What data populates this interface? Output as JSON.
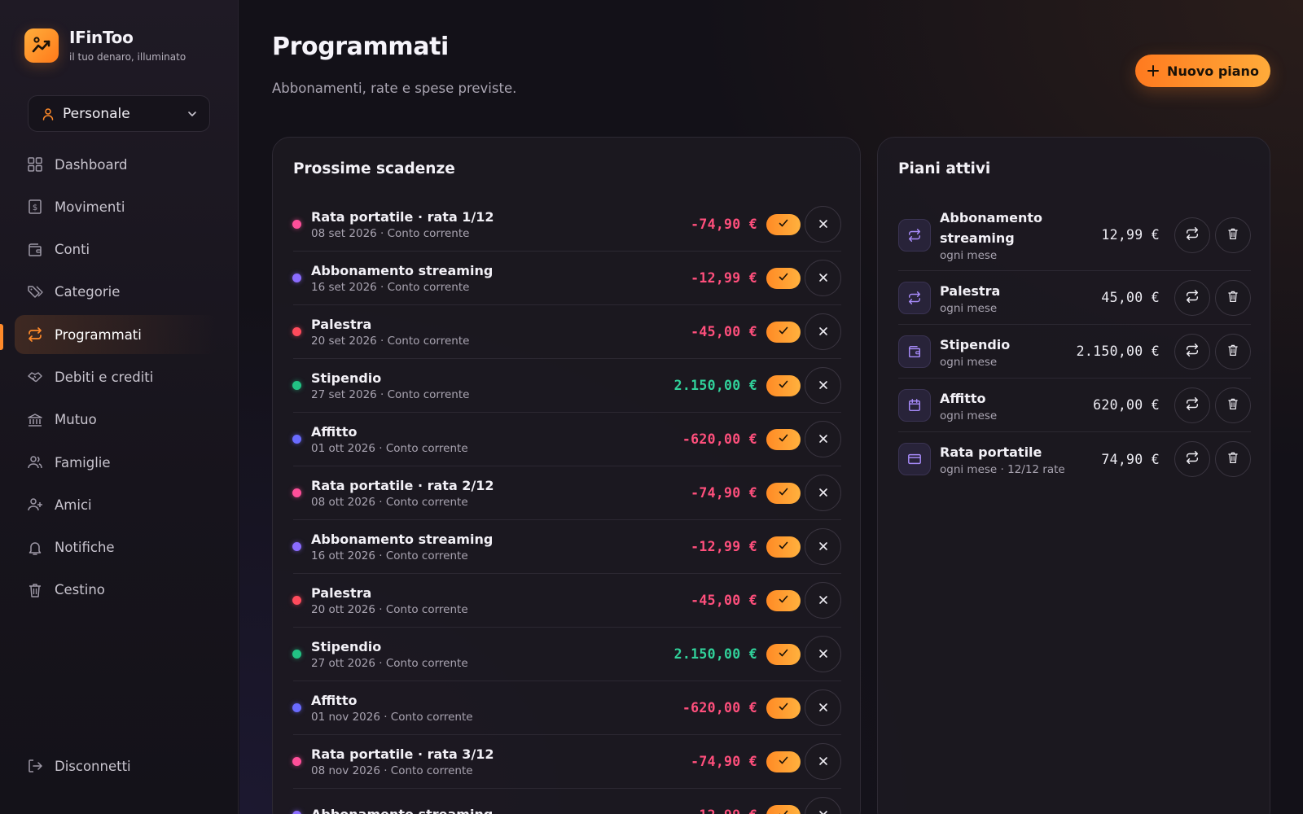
{
  "brand": {
    "name": "IFinToo",
    "tagline": "il tuo denaro, illuminato"
  },
  "profile": {
    "label": "Personale"
  },
  "nav": [
    {
      "label": "Dashboard",
      "icon": "dashboard-icon"
    },
    {
      "label": "Movimenti",
      "icon": "receipt-icon"
    },
    {
      "label": "Conti",
      "icon": "wallet-icon"
    },
    {
      "label": "Categorie",
      "icon": "tags-icon"
    },
    {
      "label": "Programmati",
      "icon": "repeat-icon",
      "active": true
    },
    {
      "label": "Debiti e crediti",
      "icon": "handshake-icon"
    },
    {
      "label": "Mutuo",
      "icon": "bank-icon"
    },
    {
      "label": "Famiglie",
      "icon": "users-icon"
    },
    {
      "label": "Amici",
      "icon": "user-plus-icon"
    },
    {
      "label": "Notifiche",
      "icon": "bell-icon"
    },
    {
      "label": "Cestino",
      "icon": "trash-icon"
    }
  ],
  "logout": {
    "label": "Disconnetti"
  },
  "page": {
    "title": "Programmati",
    "subtitle": "Abbonamenti, rate e spese previste.",
    "new_button": "Nuovo piano"
  },
  "upcoming": {
    "title": "Prossime scadenze",
    "rows": [
      {
        "title": "Rata portatile · rata 1/12",
        "meta": "08 set 2026 · Conto corrente",
        "amount": "-74,90 €",
        "sign": "neg",
        "dot": "#ff4f9a"
      },
      {
        "title": "Abbonamento streaming",
        "meta": "16 set 2026 · Conto corrente",
        "amount": "-12,99 €",
        "sign": "neg",
        "dot": "#8b6cff"
      },
      {
        "title": "Palestra",
        "meta": "20 set 2026 · Conto corrente",
        "amount": "-45,00 €",
        "sign": "neg",
        "dot": "#ff4b5c"
      },
      {
        "title": "Stipendio",
        "meta": "27 set 2026 · Conto corrente",
        "amount": "2.150,00 €",
        "sign": "pos",
        "dot": "#22c384"
      },
      {
        "title": "Affitto",
        "meta": "01 ott 2026 · Conto corrente",
        "amount": "-620,00 €",
        "sign": "neg",
        "dot": "#6a6bff"
      },
      {
        "title": "Rata portatile · rata 2/12",
        "meta": "08 ott 2026 · Conto corrente",
        "amount": "-74,90 €",
        "sign": "neg",
        "dot": "#ff4f9a"
      },
      {
        "title": "Abbonamento streaming",
        "meta": "16 ott 2026 · Conto corrente",
        "amount": "-12,99 €",
        "sign": "neg",
        "dot": "#8b6cff"
      },
      {
        "title": "Palestra",
        "meta": "20 ott 2026 · Conto corrente",
        "amount": "-45,00 €",
        "sign": "neg",
        "dot": "#ff4b5c"
      },
      {
        "title": "Stipendio",
        "meta": "27 ott 2026 · Conto corrente",
        "amount": "2.150,00 €",
        "sign": "pos",
        "dot": "#22c384"
      },
      {
        "title": "Affitto",
        "meta": "01 nov 2026 · Conto corrente",
        "amount": "-620,00 €",
        "sign": "neg",
        "dot": "#6a6bff"
      },
      {
        "title": "Rata portatile · rata 3/12",
        "meta": "08 nov 2026 · Conto corrente",
        "amount": "-74,90 €",
        "sign": "neg",
        "dot": "#ff4f9a"
      },
      {
        "title": "Abbonamento streaming",
        "meta": "",
        "amount": "-12,99 €",
        "sign": "neg",
        "dot": "#8b6cff"
      }
    ]
  },
  "plans": {
    "title": "Piani attivi",
    "rows": [
      {
        "title": "Abbonamento streaming",
        "meta": "ogni mese",
        "amount": "12,99 €",
        "icon": "repeat-icon"
      },
      {
        "title": "Palestra",
        "meta": "ogni mese",
        "amount": "45,00 €",
        "icon": "repeat-icon"
      },
      {
        "title": "Stipendio",
        "meta": "ogni mese",
        "amount": "2.150,00 €",
        "icon": "wallet-icon"
      },
      {
        "title": "Affitto",
        "meta": "ogni mese",
        "amount": "620,00 €",
        "icon": "calendar-icon"
      },
      {
        "title": "Rata portatile",
        "meta": "ogni mese · 12/12 rate",
        "amount": "74,90 €",
        "icon": "credit-card-icon"
      }
    ]
  },
  "colors": {
    "accent": "#ff8a2a",
    "negative": "#ff4f7c",
    "positive": "#31d19a"
  }
}
